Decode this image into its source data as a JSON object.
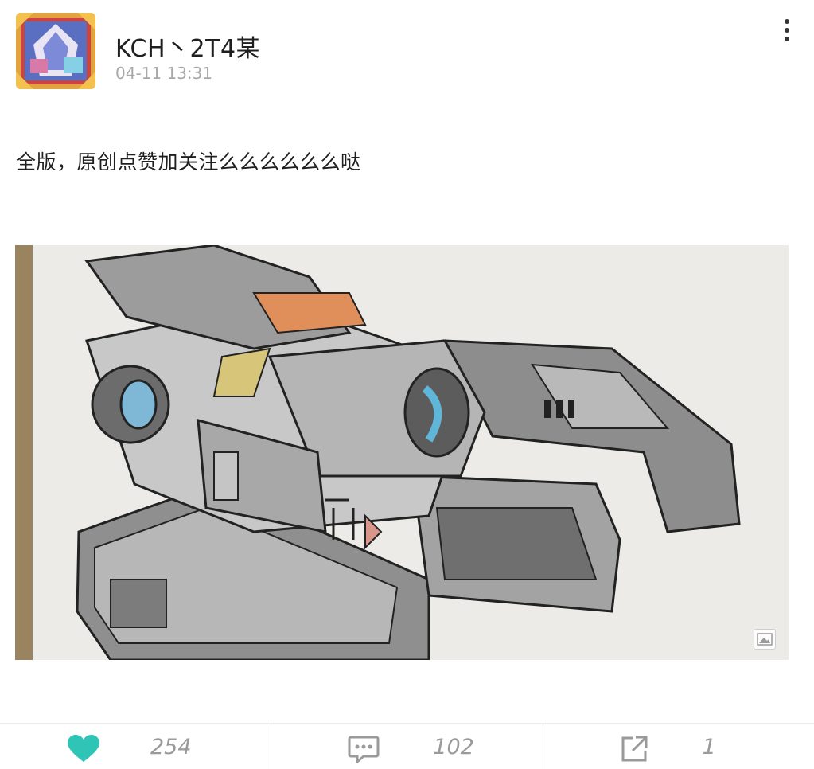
{
  "author": {
    "name": "KCH丶2T4某",
    "timestamp": "04-11 13:31"
  },
  "post": {
    "text": "全版，原创点赞加关注么么么么么么哒"
  },
  "actions": {
    "likes": "254",
    "comments": "102",
    "shares": "1"
  },
  "colors": {
    "like_accent": "#2ec4b6",
    "icon_gray": "#9a9a9a",
    "meta_gray": "#a8a8a8"
  },
  "icons": {
    "more": "more-vertical-icon",
    "like": "heart-icon",
    "comment": "comment-bubble-icon",
    "share": "share-external-icon",
    "image_badge": "image-icon"
  }
}
